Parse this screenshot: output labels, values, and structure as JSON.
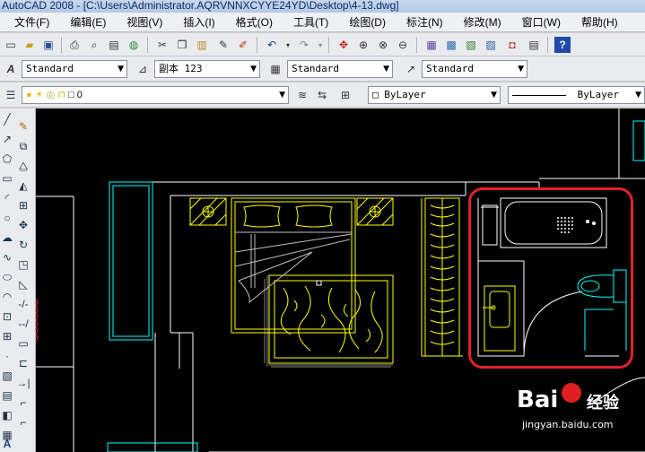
{
  "app": {
    "title": "AutoCAD 2008 - [C:\\Users\\Administrator.AQRVNNXCYYE24YD\\Desktop\\4-13.dwg]"
  },
  "menu": [
    "文件(F)",
    "编辑(E)",
    "视图(V)",
    "插入(I)",
    "格式(O)",
    "工具(T)",
    "绘图(D)",
    "标注(N)",
    "修改(M)",
    "窗口(W)",
    "帮助(H)"
  ],
  "styles": {
    "text_style": "Standard",
    "dim_style": "副本 123",
    "table_style": "Standard",
    "mleader_style": "Standard"
  },
  "layers": {
    "current_layer": "0",
    "color": "ByLayer",
    "linetype": "ByLayer"
  },
  "icons": {
    "standard_toolbar": [
      "new-icon",
      "open-icon",
      "save-icon",
      "print-icon",
      "preview-icon",
      "plot-icon",
      "publish-icon",
      "cut-icon",
      "copy-icon",
      "paste-icon",
      "match-icon",
      "brush-icon",
      "undo-icon",
      "redo-icon",
      "pan-icon",
      "zoom-realtime-icon",
      "zoom-window-icon",
      "zoom-previous-icon",
      "properties-icon",
      "designcenter-icon",
      "toolpalettes-icon",
      "sheetset-icon",
      "markup-icon",
      "calculator-icon",
      "help-icon"
    ],
    "draw_tools": [
      "line-icon",
      "polyline-icon",
      "polygon-icon",
      "rectangle-icon",
      "arc-icon",
      "circle-icon",
      "revcloud-icon",
      "spline-icon",
      "ellipse-icon",
      "ellipse-arc-icon",
      "insert-block-icon",
      "make-block-icon",
      "point-icon",
      "hatch-icon",
      "gradient-icon",
      "region-icon",
      "table-icon",
      "mtext-icon"
    ],
    "modify_tools": [
      "erase-icon",
      "copy-object-icon",
      "mirror-icon",
      "offset-icon",
      "array-icon",
      "move-icon",
      "rotate-icon",
      "scale-icon",
      "stretch-icon",
      "trim-icon",
      "extend-icon",
      "break-icon",
      "join-icon",
      "chamfer-icon",
      "fillet-icon",
      "explode-icon"
    ]
  },
  "colors": {
    "canvas": "#000000",
    "wall": "#ffffff",
    "furniture": "#ffff00",
    "fixture": "#00ffff",
    "highlight": "#e0222c"
  },
  "watermark": {
    "brand_left": "Bai",
    "brand_right": "经验",
    "url": "jingyan.baidu.com"
  }
}
